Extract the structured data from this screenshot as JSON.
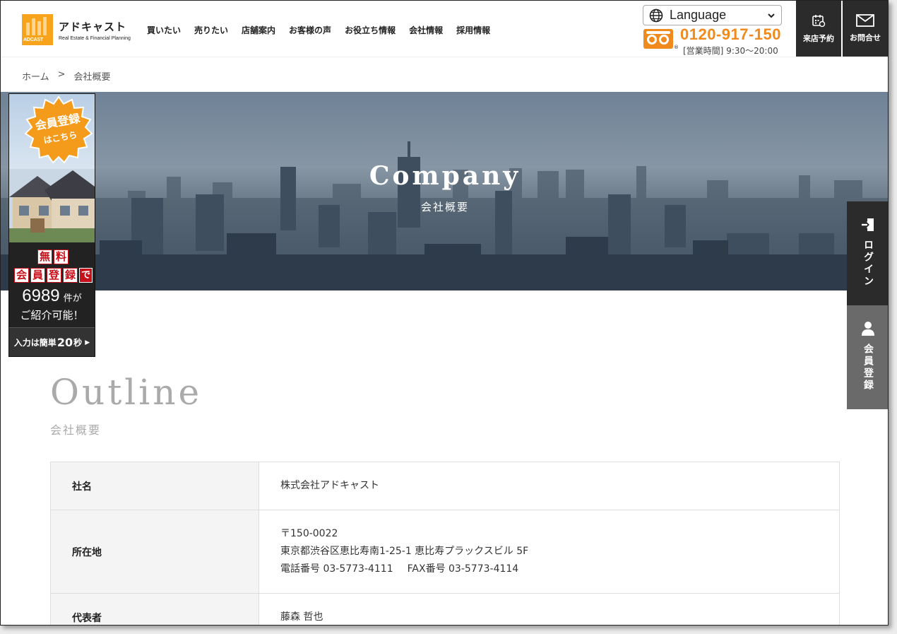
{
  "header": {
    "logo_name": "アドキャスト",
    "logo_mark_text": "ADCAST",
    "logo_sub": "Real Estate & Financial Planning",
    "nav": [
      "買いたい",
      "売りたい",
      "店舗案内",
      "お客様の声",
      "お役立ち情報",
      "会社情報",
      "採用情報"
    ],
    "language_label": "Language",
    "phone": "0120-917-150",
    "hours": "[営業時間] 9:30〜20:00",
    "reserve_label": "来店予約",
    "contact_label": "お問合せ",
    "accent_color": "#f08a1c"
  },
  "breadcrumb": {
    "home": "ホーム",
    "separator": ">",
    "current": "会社概要"
  },
  "hero": {
    "title": "Company",
    "subtitle": "会社概要"
  },
  "banner": {
    "burst_line1": "会員登録",
    "burst_line2": "はこちら",
    "muryo": [
      "無",
      "料"
    ],
    "kaiin": [
      "会",
      "員",
      "登",
      "録"
    ],
    "de": "で",
    "count": "6989",
    "count_suffix": "件が",
    "shokai": "ご紹介可能！",
    "cta_prefix": "入力は簡単",
    "cta_num": "20",
    "cta_suffix": "秒",
    "cta_arrow": "▶"
  },
  "side": {
    "login": "ログイン",
    "member": "会員登録"
  },
  "outline": {
    "title": "Outline",
    "subtitle": "会社概要"
  },
  "table": {
    "rows": [
      {
        "label": "社名",
        "lines": [
          "株式会社アドキャスト"
        ]
      },
      {
        "label": "所在地",
        "lines": [
          "〒150-0022",
          "東京都渋谷区恵比寿南1-25-1 恵比寿プラックスビル 5F"
        ],
        "tel": "電話番号 03-5773-4111",
        "fax": "FAX番号 03-5773-4114"
      },
      {
        "label": "代表者",
        "lines": [
          "藤森 哲也"
        ]
      }
    ]
  }
}
